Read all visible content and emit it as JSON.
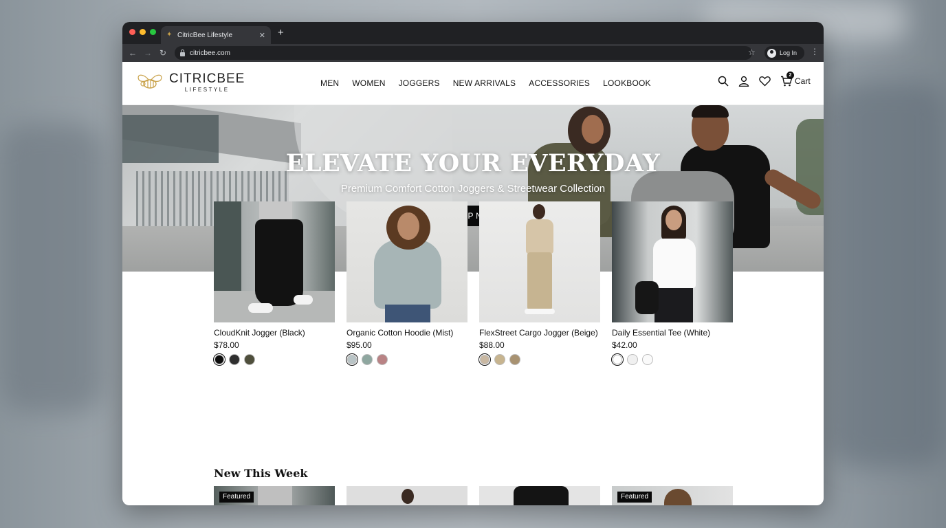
{
  "browser": {
    "tab_title": "CitricBee Lifestyle",
    "url": "citricbee.com",
    "login_label": "Log In"
  },
  "site": {
    "brand_name": "CITRICBEE",
    "brand_sub": "LIFESTYLE",
    "nav": [
      "MEN",
      "WOMEN",
      "JOGGERS",
      "NEW ARRIVALS",
      "ACCESSORIES",
      "LOOKBOOK"
    ],
    "cart_label": "Cart",
    "cart_count": "2",
    "icons": [
      "search-icon",
      "account-icon",
      "wishlist-heart-icon",
      "cart-icon"
    ]
  },
  "hero": {
    "title": "ELEVATE YOUR EVERYDAY",
    "subtitle": "Premium Comfort Cotton Joggers & Streetwear Collection",
    "cta": "SHOP NOW"
  },
  "products": [
    {
      "name": "CloudKnit Jogger (Black)",
      "price": "$78.00",
      "swatches": [
        "#0d0d0d",
        "#2f2f2f",
        "#4f4f3c"
      ],
      "selected": 0
    },
    {
      "name": "Organic Cotton Hoodie (Mist)",
      "price": "$95.00",
      "swatches": [
        "#b9c4c6",
        "#8fa7a0",
        "#b98385"
      ],
      "selected": 0
    },
    {
      "name": "FlexStreet Cargo Jogger (Beige)",
      "price": "$88.00",
      "swatches": [
        "#c9b8a2",
        "#c7b48f",
        "#a89271"
      ],
      "selected": 0
    },
    {
      "name": "Daily Essential Tee (White)",
      "price": "$42.00",
      "swatches": [
        "#ffffff",
        "#f0f0f0",
        "#fafafa"
      ],
      "selected": 0
    }
  ],
  "new_this_week": {
    "title": "New This Week",
    "badges": [
      "Featured",
      "",
      "",
      "Featured"
    ]
  },
  "colors": {
    "accent": "#0a0a0a",
    "brand_gold": "#c9a24a"
  }
}
